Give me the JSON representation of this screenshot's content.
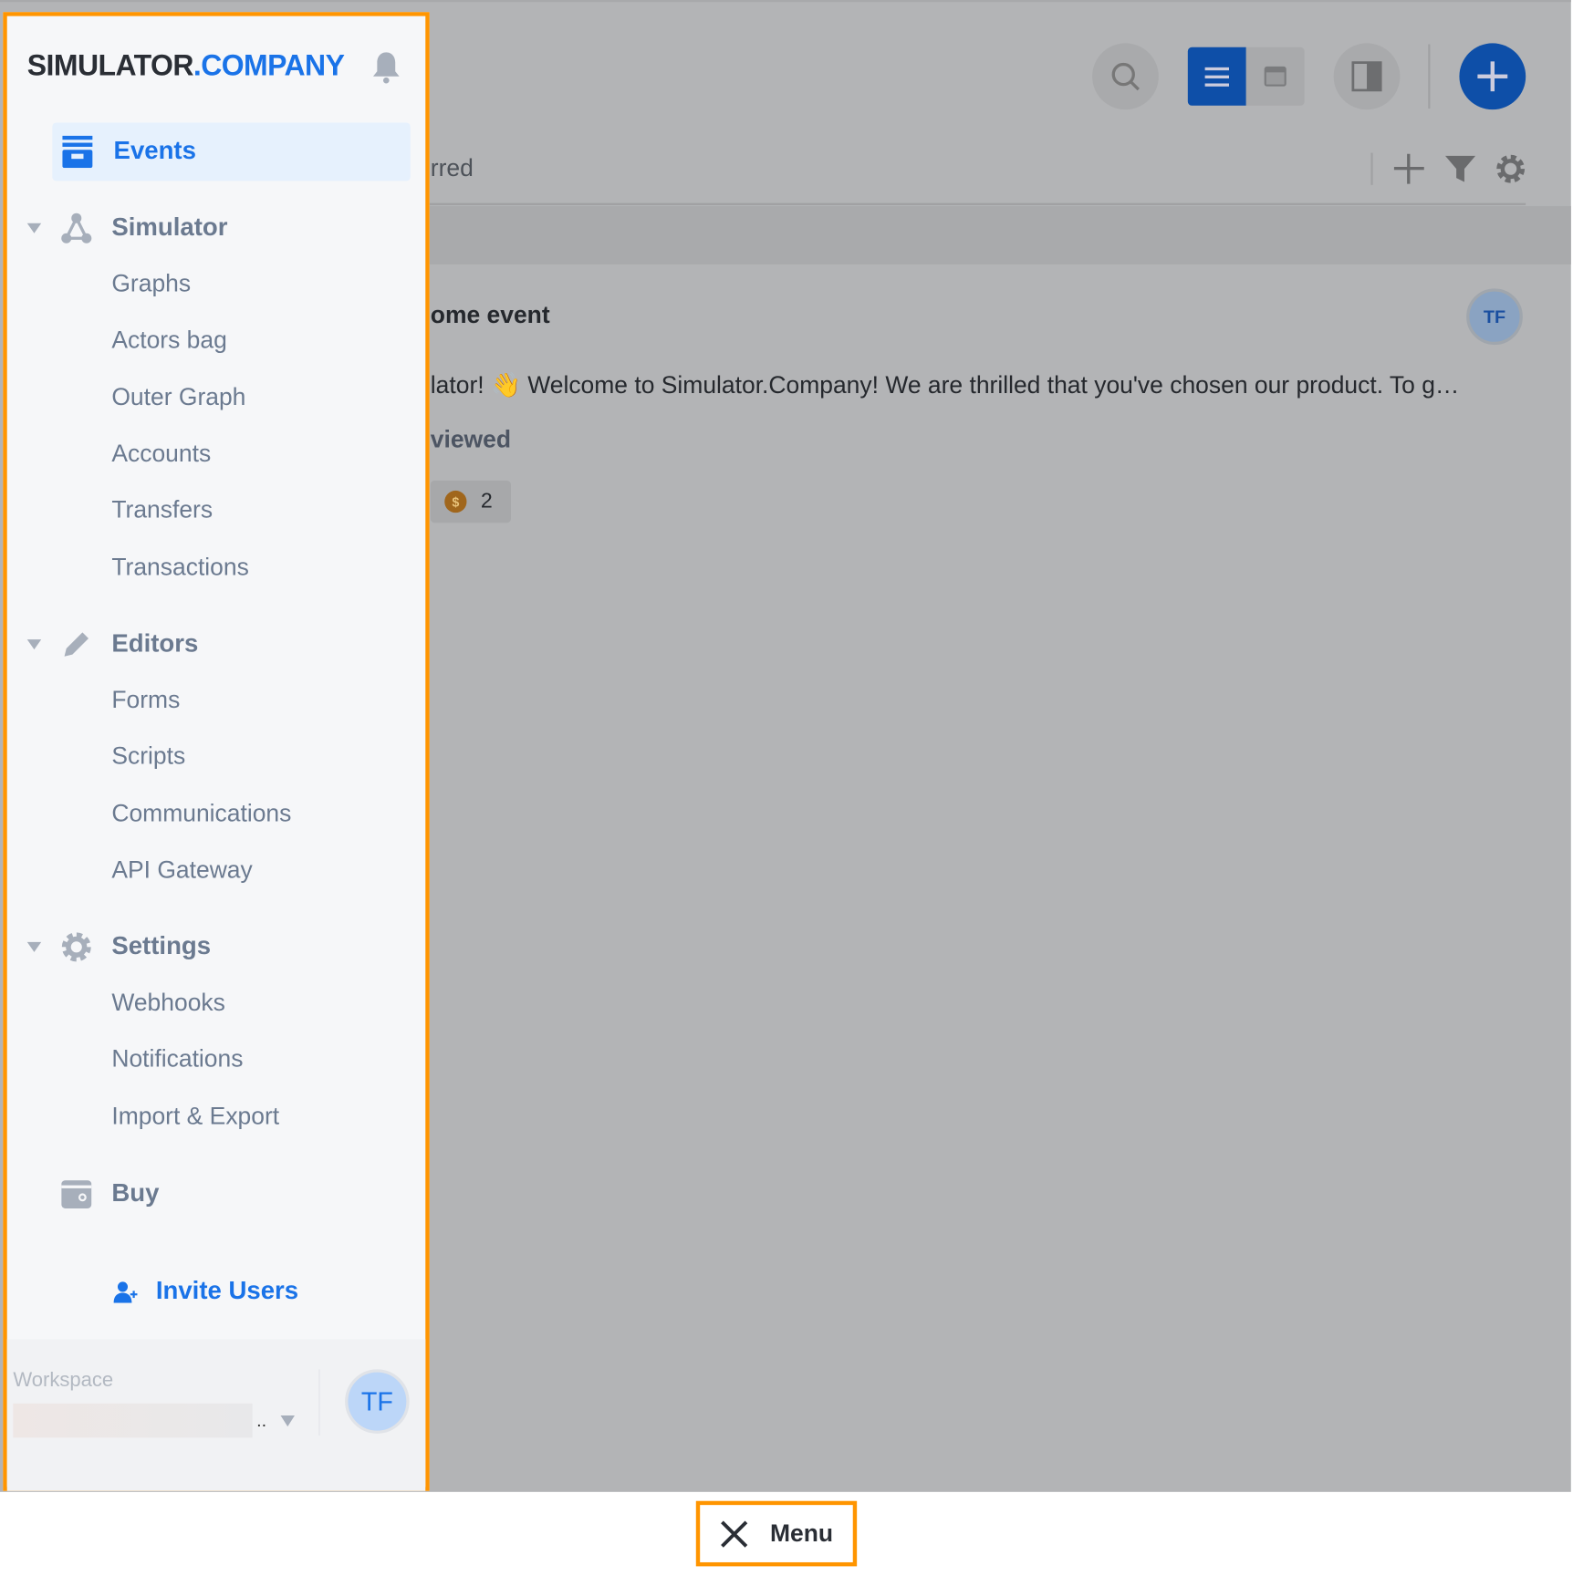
{
  "brand": {
    "part1": "SIMULATOR",
    "part2": ".COMPANY"
  },
  "sidebar": {
    "active": {
      "label": "Events",
      "icon": "events-icon"
    },
    "sections": [
      {
        "label": "Simulator",
        "icon": "graph-nodes-icon",
        "items": [
          "Graphs",
          "Actors bag",
          "Outer Graph",
          "Accounts",
          "Transfers",
          "Transactions"
        ]
      },
      {
        "label": "Editors",
        "icon": "pencil-icon",
        "items": [
          "Forms",
          "Scripts",
          "Communications",
          "API Gateway"
        ]
      },
      {
        "label": "Settings",
        "icon": "gear-icon",
        "items": [
          "Webhooks",
          "Notifications",
          "Import & Export"
        ]
      }
    ],
    "buy": "Buy",
    "invite": "Invite Users",
    "workspace_label": "Workspace",
    "workspace_value_suffix": "..",
    "avatar": "TF"
  },
  "main": {
    "tab_partial": "rred",
    "event_title": "ome event",
    "event_text": "lator! 👋 Welcome to Simulator.Company! We are thrilled that you've chosen our product. To g…",
    "viewed": "viewed",
    "coin_count": "2",
    "avatar": "TF"
  },
  "bottom": {
    "menu_label": "Menu"
  },
  "colors": {
    "accent": "#1a73e8",
    "highlight": "#ff9500",
    "overlay": "#b3b4b6"
  }
}
